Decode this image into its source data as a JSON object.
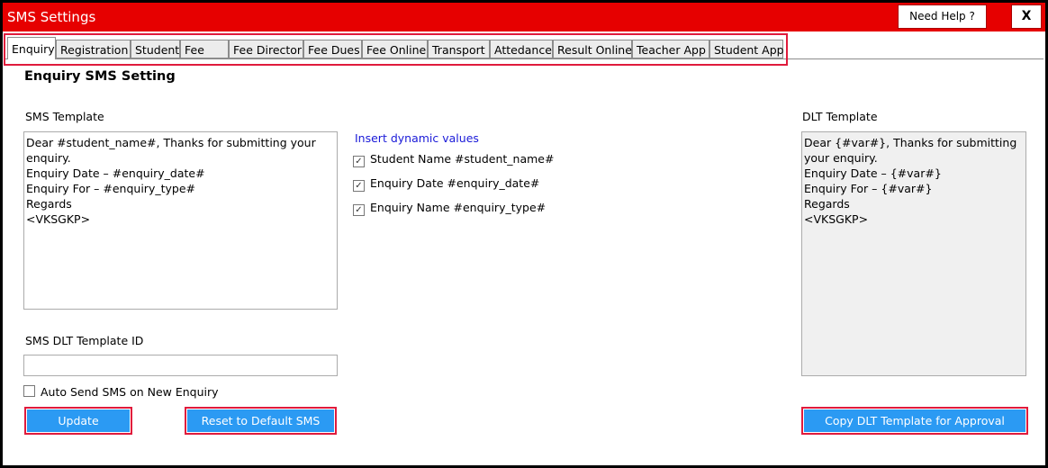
{
  "window": {
    "title": "SMS Settings",
    "help_label": "Need Help ?",
    "close_label": "X"
  },
  "tabs": [
    {
      "label": "Enquiry",
      "active": true
    },
    {
      "label": "Registration"
    },
    {
      "label": "Student"
    },
    {
      "label": "Fee"
    },
    {
      "label": "Fee Director"
    },
    {
      "label": "Fee Dues"
    },
    {
      "label": "Fee Online"
    },
    {
      "label": "Transport"
    },
    {
      "label": "Attedance"
    },
    {
      "label": "Result Online"
    },
    {
      "label": "Teacher App"
    },
    {
      "label": "Student App"
    }
  ],
  "main": {
    "heading": "Enquiry SMS Setting",
    "sms_template_label": "SMS Template",
    "sms_template_value": "Dear #student_name#, Thanks for submitting your enquiry.\nEnquiry Date – #enquiry_date#\nEnquiry For – #enquiry_type#\nRegards\n<VKSGKP>",
    "insert_label": "Insert dynamic values",
    "dynamic_values": [
      {
        "label": "Student Name #student_name#",
        "checked": true
      },
      {
        "label": "Enquiry Date #enquiry_date#",
        "checked": true
      },
      {
        "label": "Enquiry Name #enquiry_type#",
        "checked": true
      }
    ],
    "dlt_template_label": "DLT Template",
    "dlt_template_value": "Dear {#var#}, Thanks for submitting your enquiry.\nEnquiry Date – {#var#}\nEnquiry For – {#var#}\nRegards\n<VKSGKP>",
    "dlt_id_label": "SMS DLT Template ID",
    "dlt_id_value": "",
    "auto_send_label": "Auto Send SMS on New Enquiry",
    "auto_send_checked": false,
    "update_label": "Update",
    "reset_label": "Reset to Default SMS",
    "copy_label": "Copy DLT Template for Approval"
  },
  "colors": {
    "titlebar": "#e60000",
    "button": "#2b9af3",
    "highlight": "#e01b3c",
    "link": "#1a1ad8"
  }
}
